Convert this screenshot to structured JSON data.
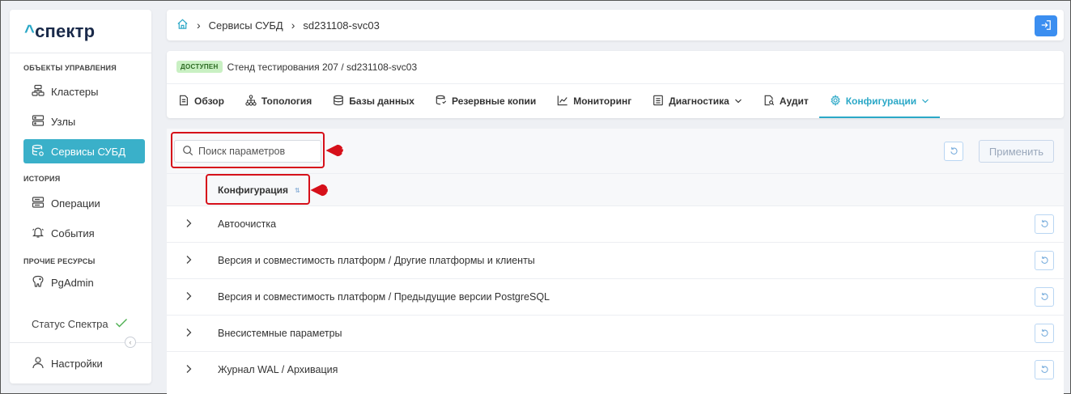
{
  "app": {
    "logo_caret": "^",
    "logo_text": "спектр"
  },
  "sidebar": {
    "section_objects": "ОБЪЕКТЫ УПРАВЛЕНИЯ",
    "clusters": "Кластеры",
    "nodes": "Узлы",
    "dbms_services": "Сервисы СУБД",
    "section_history": "ИСТОРИЯ",
    "operations": "Операции",
    "events": "События",
    "section_other": "ПРОЧИЕ РЕСУРСЫ",
    "pgadmin": "PgAdmin",
    "status": "Статус Спектра",
    "settings": "Настройки"
  },
  "breadcrumb": {
    "level1": "Сервисы СУБД",
    "level2": "sd231108-svc03"
  },
  "service": {
    "badge": "ДОСТУПЕН",
    "title": "Стенд тестирования 207 /  sd231108-svc03"
  },
  "tabs": {
    "overview": "Обзор",
    "topology": "Топология",
    "databases": "Базы данных",
    "backups": "Резервные копии",
    "monitoring": "Мониторинг",
    "diagnostics": "Диагностика",
    "audit": "Аудит",
    "configuration": "Конфигурации"
  },
  "toolbar": {
    "search_placeholder": "Поиск параметров",
    "apply": "Применить"
  },
  "table": {
    "column": "Конфигурация",
    "sort_glyph": "⇅",
    "rows": [
      "Автоочистка",
      "Версия и совместимость платформ / Другие платформы и клиенты",
      "Версия и совместимость платформ / Предыдущие версии PostgreSQL",
      "Внесистемные параметры",
      "Журнал WAL / Архивация"
    ]
  },
  "callouts": {
    "one": "1",
    "two": "2",
    "color": "#d6101a"
  },
  "colors": {
    "accent": "#2ba8c7",
    "active_nav": "#3ab0c9",
    "logout": "#3b8ef0",
    "ok": "#4caf50"
  }
}
